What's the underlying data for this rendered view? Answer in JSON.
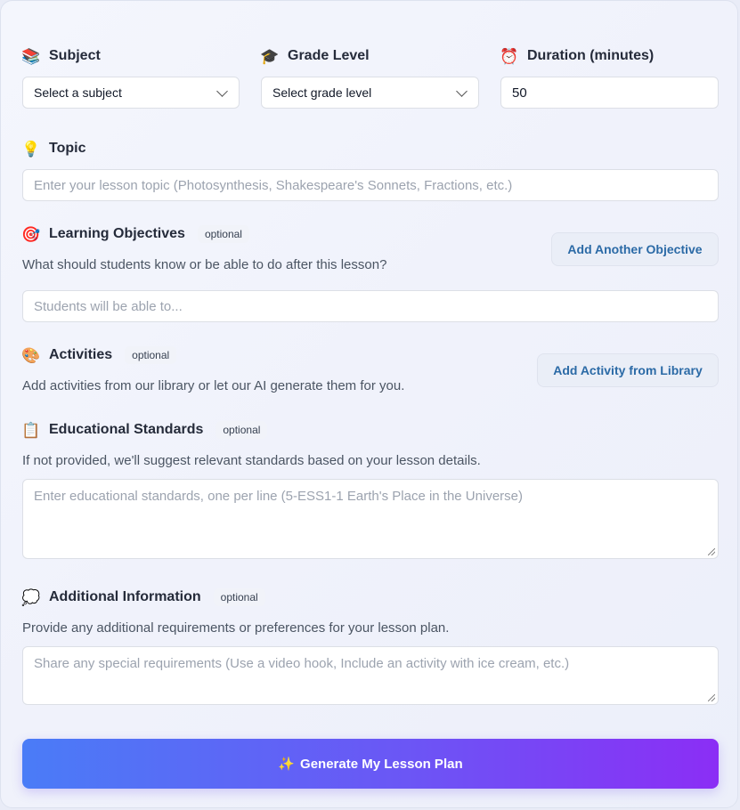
{
  "subject": {
    "icon": "books-icon",
    "label": "Subject",
    "value": "Select a subject"
  },
  "grade": {
    "icon": "graduation-cap-icon",
    "label": "Grade Level",
    "value": "Select grade level"
  },
  "duration": {
    "icon": "alarm-clock-icon",
    "label": "Duration (minutes)",
    "value": "50"
  },
  "topic": {
    "icon": "light-bulb-icon",
    "label": "Topic",
    "placeholder": "Enter your lesson topic (Photosynthesis, Shakespeare's Sonnets, Fractions, etc.)"
  },
  "objectives": {
    "icon": "target-icon",
    "label": "Learning Objectives",
    "badge": "optional",
    "help": "What should students know or be able to do after this lesson?",
    "button": "Add Another Objective",
    "placeholder": "Students will be able to..."
  },
  "activities": {
    "icon": "palette-icon",
    "label": "Activities",
    "badge": "optional",
    "help": "Add activities from our library or let our AI generate them for you.",
    "button": "Add Activity from Library"
  },
  "standards": {
    "icon": "clipboard-icon",
    "label": "Educational Standards",
    "badge": "optional",
    "help": "If not provided, we'll suggest relevant standards based on your lesson details.",
    "placeholder": "Enter educational standards, one per line (5-ESS1-1 Earth's Place in the Universe)"
  },
  "additional": {
    "icon": "thought-bubble-icon",
    "label": "Additional Information",
    "badge": "optional",
    "help": "Provide any additional requirements or preferences for your lesson plan.",
    "placeholder": "Share any special requirements (Use a video hook, Include an activity with ice cream, etc.)"
  },
  "generate": {
    "icon": "sparkles-icon",
    "label": "Generate My Lesson Plan"
  },
  "colors": {
    "accent_start": "#4a7cf7",
    "accent_end": "#8b2ef5",
    "secondary_button_text": "#2b6aa6"
  }
}
